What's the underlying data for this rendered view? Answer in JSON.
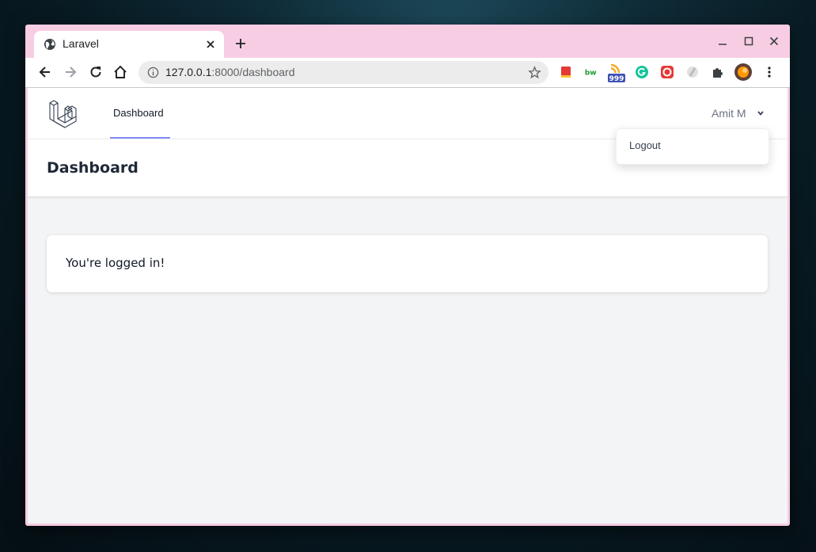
{
  "browser": {
    "tab_title": "Laravel",
    "url_host": "127.0.0.1",
    "url_path": ":8000/dashboard",
    "extensions": [
      {
        "name": "red-book-extension",
        "color": "#e53935"
      },
      {
        "name": "bw-extension",
        "label": "bw",
        "color": "#1a9c2e"
      },
      {
        "name": "rss-extension",
        "badge": "999",
        "color": "#f9a825"
      },
      {
        "name": "grammarly-extension",
        "color": "#15c39a"
      },
      {
        "name": "red-chat-extension",
        "color": "#e53935"
      },
      {
        "name": "grey-extension",
        "color": "#bdbdbd"
      }
    ]
  },
  "app": {
    "nav_dashboard": "Dashboard",
    "user_name": "Amit M",
    "dropdown_logout": "Logout",
    "header_title": "Dashboard",
    "message": "You're logged in!",
    "accent": "#818cf8"
  }
}
